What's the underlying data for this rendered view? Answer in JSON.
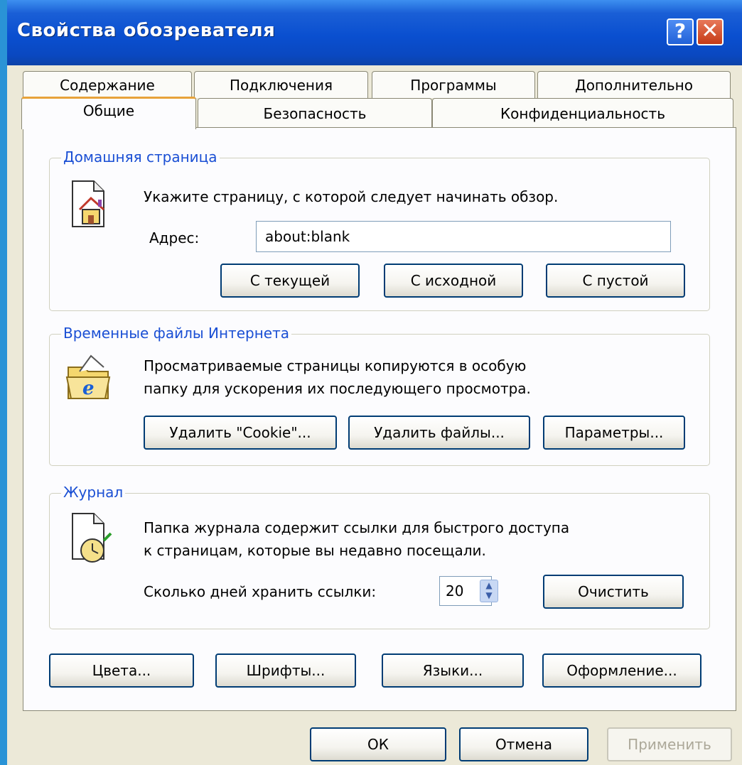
{
  "window": {
    "title": "Свойства обозревателя",
    "help_glyph": "?",
    "close_glyph": "✕"
  },
  "tabs": {
    "row1": [
      "Содержание",
      "Подключения",
      "Программы",
      "Дополнительно"
    ],
    "row2": [
      "Общие",
      "Безопасность",
      "Конфиденциальность"
    ],
    "active": "Общие"
  },
  "home": {
    "label": "Домашняя страница",
    "icon": "home-page-icon",
    "desc": "Укажите страницу, с которой следует начинать обзор.",
    "address_label": "Адрес:",
    "address_value": "about:blank",
    "buttons": [
      "С текущей",
      "С исходной",
      "С пустой"
    ]
  },
  "temp": {
    "label": "Временные файлы Интернета",
    "icon": "ie-folder-icon",
    "desc_line1": "Просматриваемые страницы копируются в особую",
    "desc_line2": "папку для ускорения их последующего просмотра.",
    "buttons": [
      "Удалить \"Cookie\"...",
      "Удалить файлы...",
      "Параметры..."
    ]
  },
  "history": {
    "label": "Журнал",
    "icon": "history-clock-icon",
    "desc_line1": "Папка журнала содержит ссылки для быстрого доступа",
    "desc_line2": "к страницам, которые вы недавно посещали.",
    "days_label": "Сколько дней хранить ссылки:",
    "days_value": "20",
    "clear_button": "Очистить"
  },
  "bottom_buttons": [
    "Цвета...",
    "Шрифты...",
    "Языки...",
    "Оформление..."
  ],
  "dialog_buttons": {
    "ok": "ОК",
    "cancel": "Отмена",
    "apply": "Применить"
  }
}
